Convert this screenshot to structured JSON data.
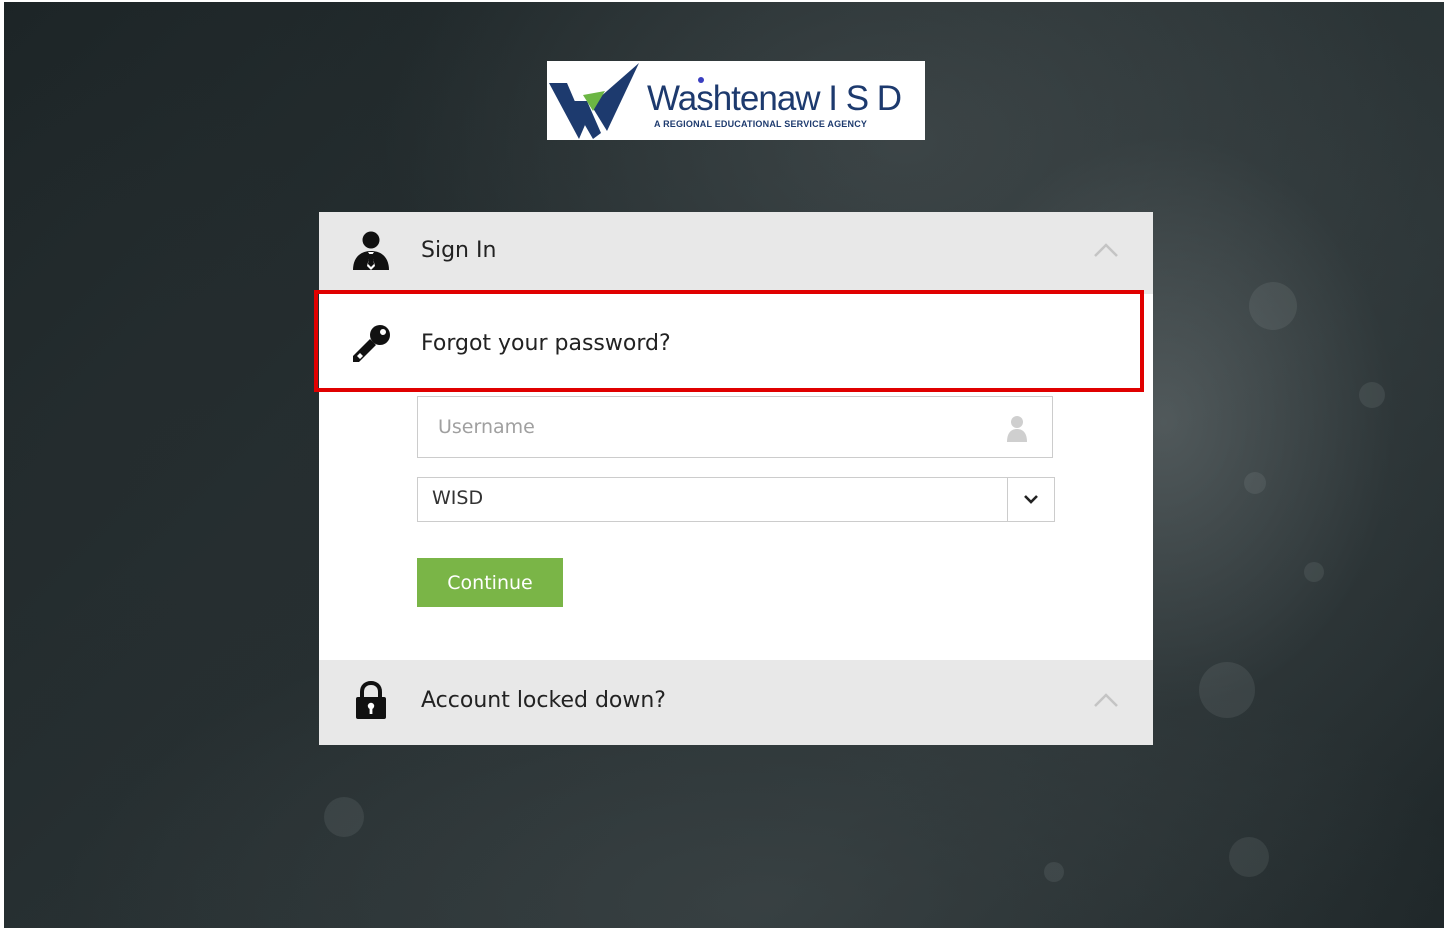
{
  "logo": {
    "name": "Washtenaw ISD",
    "name_display": "Washtenaw  I S D",
    "tagline": "A REGIONAL EDUCATIONAL SERVICE AGENCY"
  },
  "sections": {
    "sign_in": {
      "label": "Sign In",
      "icon": "user-icon"
    },
    "forgot_password": {
      "label": "Forgot your password?",
      "icon": "key-icon"
    },
    "account_locked": {
      "label": "Account locked down?",
      "icon": "lock-icon"
    }
  },
  "form": {
    "username": {
      "placeholder": "Username",
      "value": ""
    },
    "domain_select": {
      "selected": "WISD"
    },
    "continue_label": "Continue"
  },
  "colors": {
    "accent_green": "#7ab547",
    "highlight_red": "#e00000",
    "header_gray": "#e8e8e8",
    "logo_navy": "#1d3a6e"
  }
}
